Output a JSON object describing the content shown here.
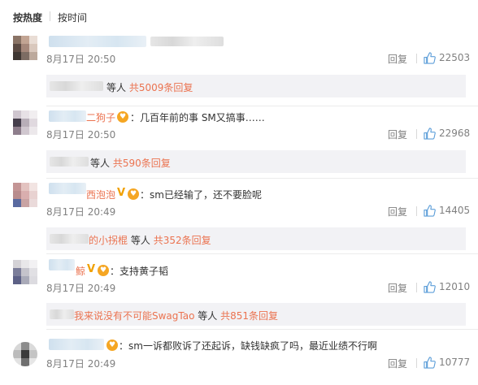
{
  "sort": {
    "hot_label": "按热度",
    "time_label": "按时间"
  },
  "actions": {
    "reply_label": "回复"
  },
  "colors": {
    "link": "#eb7350",
    "muted": "#808080",
    "sub_bg": "#f2f2f5",
    "like": "#5e9fd9"
  },
  "comments": [
    {
      "nickname": "",
      "text": "",
      "time": "8月17日 20:50",
      "likes": "22503",
      "sub": {
        "partial_name": "",
        "prefix": "等人",
        "count_link": "共5009条回复"
      }
    },
    {
      "nickname": "二狗子",
      "text": "：几百年前的事 SM又搞事……",
      "time": "8月17日 20:50",
      "likes": "22968",
      "sub": {
        "partial_name": "",
        "prefix": "等人",
        "count_link": "共590条回复"
      }
    },
    {
      "nickname": "西泡泡",
      "text": "：sm已经输了，还不要脸呢",
      "time": "8月17日 20:49",
      "likes": "14405",
      "sub": {
        "partial_name": "的小拐棍",
        "prefix": "等人",
        "count_link": "共352条回复"
      }
    },
    {
      "nickname": "鲸",
      "text": "：支持黄子韬",
      "time": "8月17日 20:49",
      "likes": "12010",
      "sub": {
        "partial_name": "我来说没有不可能SwagTao",
        "prefix": "等人",
        "count_link": "共851条回复"
      }
    },
    {
      "nickname": "",
      "text": "：sm一诉都败诉了还起诉，缺钱缺疯了吗，最近业绩不行啊",
      "time": "8月17日 20:49",
      "likes": "10777",
      "sub": null
    }
  ]
}
